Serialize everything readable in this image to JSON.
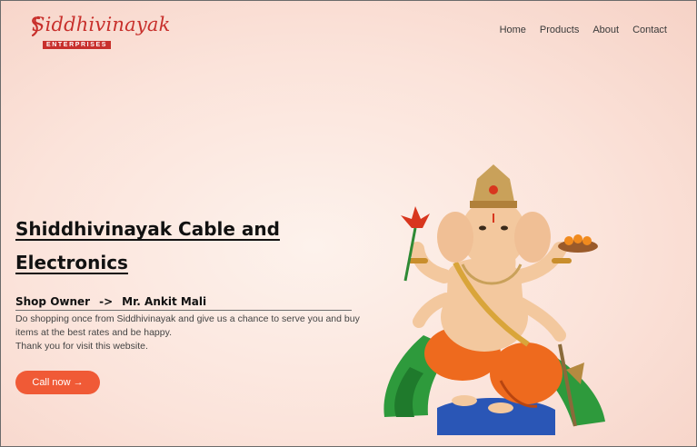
{
  "brand": {
    "name": "Siddhivinayak",
    "tagline": "ENTERPRISES"
  },
  "nav": {
    "items": [
      "Home",
      "Products",
      "About",
      "Contact"
    ]
  },
  "hero": {
    "title": "Shiddhivinayak Cable and Electronics",
    "owner_label": "Shop Owner",
    "owner_arrow": "->",
    "owner_name": "Mr. Ankit Mali",
    "description_1": "Do shopping once from Siddhivinayak and give us a chance to serve you and buy items at the best rates and be happy.",
    "description_2": "Thank you for visit this website.",
    "cta_label": "Call now →"
  },
  "colors": {
    "brand_red": "#c8302c",
    "cta_orange": "#f05a36",
    "background": "#fbe3da"
  },
  "icons": {
    "hero_image": "ganesha-illustration",
    "logo_mark": "swirl-icon"
  }
}
